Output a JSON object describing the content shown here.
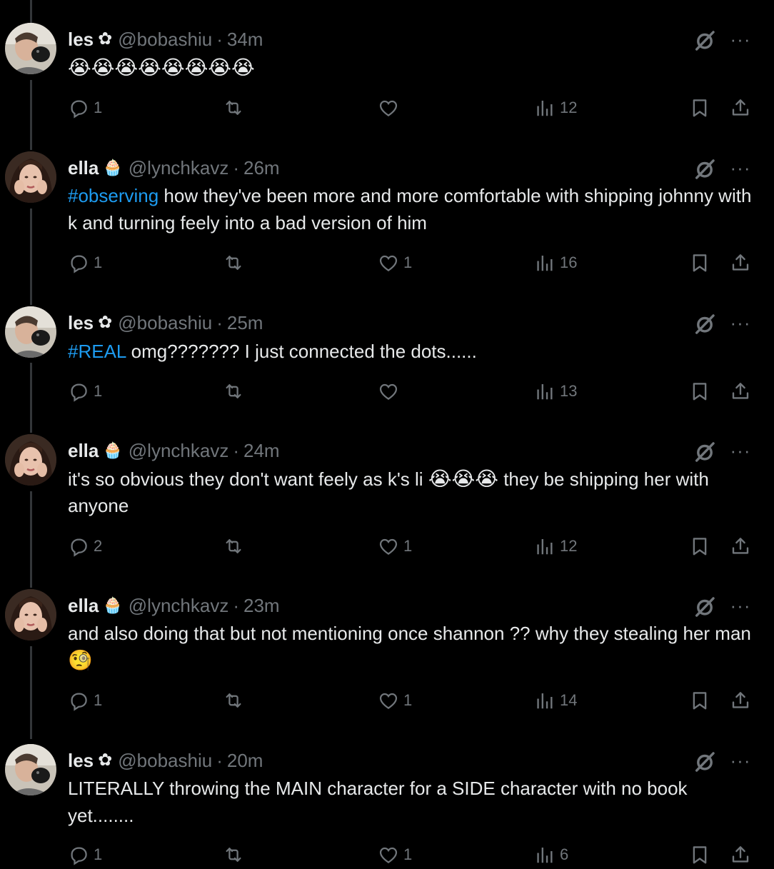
{
  "thread": [
    {
      "name": "les",
      "badge": "✿",
      "handle": "@bobashiu",
      "time": "34m",
      "hashtag": "",
      "text": "",
      "emoji": "😭😭😭😭😭😭😭😭",
      "text2": "",
      "stats": {
        "replies": "1",
        "retweets": "",
        "likes": "",
        "views": "12"
      }
    },
    {
      "name": "ella",
      "badge": "🧁",
      "handle": "@lynchkavz",
      "time": "26m",
      "hashtag": "#observing",
      "text": " how they've been more and more comfortable with shipping johnny with k and turning feely into a bad version of him",
      "emoji": "",
      "text2": "",
      "stats": {
        "replies": "1",
        "retweets": "",
        "likes": "1",
        "views": "16"
      }
    },
    {
      "name": "les",
      "badge": "✿",
      "handle": "@bobashiu",
      "time": "25m",
      "hashtag": "#REAL",
      "text": " omg??????? I just connected the dots......",
      "emoji": "",
      "text2": "",
      "stats": {
        "replies": "1",
        "retweets": "",
        "likes": "",
        "views": "13"
      }
    },
    {
      "name": "ella",
      "badge": "🧁",
      "handle": "@lynchkavz",
      "time": "24m",
      "hashtag": "",
      "text": "it's so obvious they don't want feely as k's li ",
      "emoji": "😭😭😭",
      "text2": " they be shipping her with anyone",
      "stats": {
        "replies": "2",
        "retweets": "",
        "likes": "1",
        "views": "12"
      }
    },
    {
      "name": "ella",
      "badge": "🧁",
      "handle": "@lynchkavz",
      "time": "23m",
      "hashtag": "",
      "text": "and also doing that but not mentioning once shannon ??  why they stealing her man ",
      "emoji": "🧐",
      "text2": "",
      "stats": {
        "replies": "1",
        "retweets": "",
        "likes": "1",
        "views": "14"
      }
    },
    {
      "name": "les",
      "badge": "✿",
      "handle": "@bobashiu",
      "time": "20m",
      "hashtag": "",
      "text": "LITERALLY throwing the MAIN character for a SIDE character with no book yet........",
      "emoji": "",
      "text2": "",
      "stats": {
        "replies": "1",
        "retweets": "",
        "likes": "1",
        "views": "6"
      }
    }
  ],
  "header": {
    "separator": "·"
  },
  "icons": {
    "reply": "reply-icon",
    "retweet": "retweet-icon",
    "like": "heart-icon",
    "views": "views-icon",
    "bookmark": "bookmark-icon",
    "share": "share-icon",
    "grok": "grok-icon",
    "more": "more-icon"
  },
  "colors": {
    "background": "#000000",
    "text": "#e7e9ea",
    "muted": "#71767b",
    "link": "#1d9bf0",
    "thread_line": "#333639"
  }
}
